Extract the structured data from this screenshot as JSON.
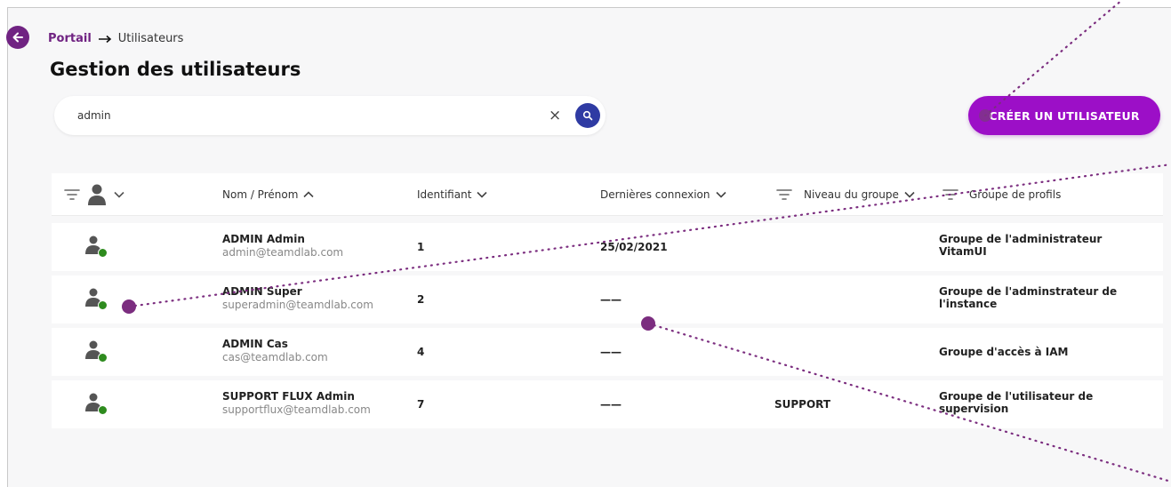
{
  "breadcrumb": {
    "portal": "Portail",
    "current": "Utilisateurs"
  },
  "page": {
    "title": "Gestion des utilisateurs"
  },
  "search": {
    "value": "admin",
    "clear_glyph": "×"
  },
  "actions": {
    "create_label": "CRÉER UN UTILISATEUR"
  },
  "table": {
    "headers": {
      "name": "Nom / Prénom",
      "identifier": "Identifiant",
      "last_connection": "Dernières connexion",
      "group_level": "Niveau du groupe",
      "profile_group": "Groupe de profils"
    },
    "rows": [
      {
        "name": "ADMIN Admin",
        "email": "admin@teamdlab.com",
        "id": "1",
        "last_connection": "25/02/2021",
        "level": "",
        "group_line1": "Groupe de l'administrateur",
        "group_line2": "VitamUI"
      },
      {
        "name": "ADMIN Super",
        "email": "superadmin@teamdlab.com",
        "id": "2",
        "last_connection": "——",
        "level": "",
        "group_line1": "Groupe de l'adminstrateur de",
        "group_line2": "l'instance"
      },
      {
        "name": "ADMIN Cas",
        "email": "cas@teamdlab.com",
        "id": "4",
        "last_connection": "——",
        "level": "",
        "group_line1": "Groupe d'accès à IAM",
        "group_line2": ""
      },
      {
        "name": "SUPPORT FLUX Admin",
        "email": "supportflux@teamdlab.com",
        "id": "7",
        "last_connection": "——",
        "level": "SUPPORT",
        "group_line1": "Groupe de l'utilisateur de",
        "group_line2": "supervision"
      }
    ]
  },
  "colors": {
    "brand": "#702382",
    "accent_button": "#9c0fc7",
    "search_button": "#2f3ba3",
    "status_active": "#2e8b1e",
    "annotation": "#7b2d7f"
  }
}
